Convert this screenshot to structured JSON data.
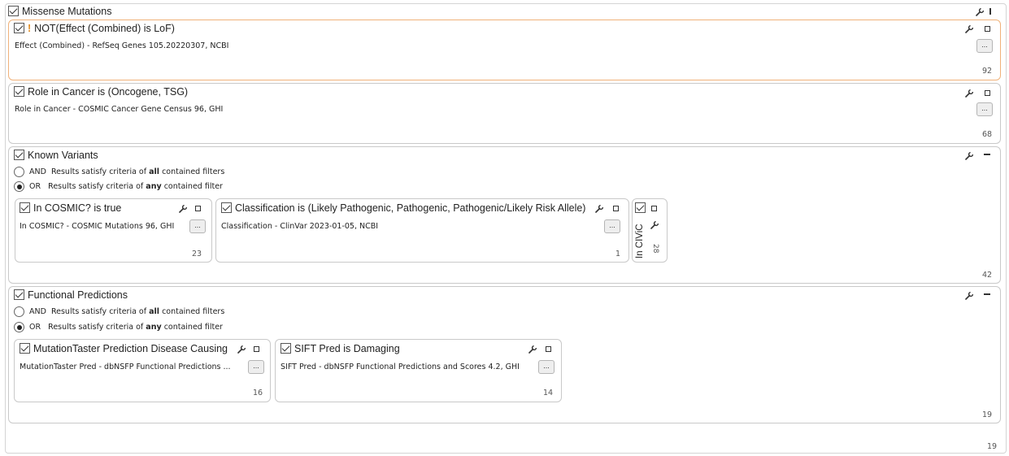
{
  "root": {
    "title": "Missense Mutations",
    "count": "19"
  },
  "filters": {
    "not_effect": {
      "warn": "!",
      "title": "NOT(Effect (Combined) is LoF)",
      "source": "Effect (Combined) - RefSeq Genes 105.20220307, NCBI",
      "more": "...",
      "count": "92"
    },
    "role_cancer": {
      "title": "Role in Cancer is (Oncogene, TSG)",
      "source": "Role in Cancer - COSMIC Cancer Gene Census 96, GHI",
      "more": "...",
      "count": "68"
    }
  },
  "known_variants": {
    "title": "Known Variants",
    "and_opt": {
      "prefix": "AND",
      "text_a": "Results satisfy criteria of ",
      "bold": "all",
      "text_b": " contained filters"
    },
    "or_opt": {
      "prefix": "OR",
      "text_a": "Results satisfy criteria of ",
      "bold": "any",
      "text_b": " contained filter"
    },
    "count": "42",
    "children": [
      {
        "title": "In COSMIC? is true",
        "source": "In COSMIC? - COSMIC Mutations 96, GHI",
        "more": "...",
        "count": "23"
      },
      {
        "title": "Classification is (Likely Pathogenic, Pathogenic, Pathogenic/Likely Risk Allele)",
        "source": "Classification - ClinVar 2023-01-05, NCBI",
        "more": "...",
        "count": "1"
      },
      {
        "title": "In CIViC",
        "count": "28"
      }
    ]
  },
  "functional": {
    "title": "Functional Predictions",
    "and_opt": {
      "prefix": "AND",
      "text_a": "Results satisfy criteria of ",
      "bold": "all",
      "text_b": " contained filters"
    },
    "or_opt": {
      "prefix": "OR",
      "text_a": "Results satisfy criteria of ",
      "bold": "any",
      "text_b": " contained filter"
    },
    "count": "19",
    "children": [
      {
        "title": "MutationTaster Prediction Disease Causing",
        "source": "MutationTaster Pred - dbNSFP Functional Predictions ...",
        "more": "...",
        "count": "16"
      },
      {
        "title": "SIFT Pred is Damaging",
        "source": "SIFT Pred - dbNSFP Functional Predictions and Scores 4.2, GHI",
        "more": "...",
        "count": "14"
      }
    ]
  }
}
